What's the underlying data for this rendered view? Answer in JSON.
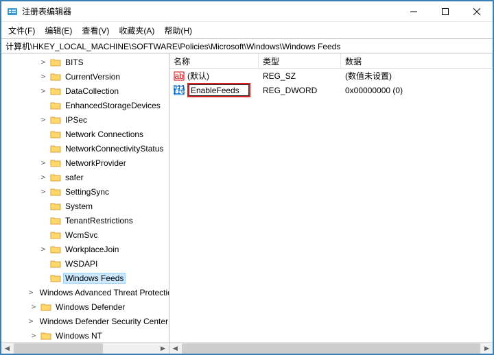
{
  "window": {
    "title": "注册表编辑器"
  },
  "menu": {
    "file": "文件(F)",
    "edit": "编辑(E)",
    "view": "查看(V)",
    "favorites": "收藏夹(A)",
    "help": "帮助(H)"
  },
  "address": {
    "path": "计算机\\HKEY_LOCAL_MACHINE\\SOFTWARE\\Policies\\Microsoft\\Windows\\Windows Feeds"
  },
  "tree": {
    "items": [
      {
        "indent": 54,
        "exp": ">",
        "label": "BITS"
      },
      {
        "indent": 54,
        "exp": ">",
        "label": "CurrentVersion"
      },
      {
        "indent": 54,
        "exp": ">",
        "label": "DataCollection"
      },
      {
        "indent": 54,
        "exp": "",
        "label": "EnhancedStorageDevices"
      },
      {
        "indent": 54,
        "exp": ">",
        "label": "IPSec"
      },
      {
        "indent": 54,
        "exp": "",
        "label": "Network Connections"
      },
      {
        "indent": 54,
        "exp": "",
        "label": "NetworkConnectivityStatus"
      },
      {
        "indent": 54,
        "exp": ">",
        "label": "NetworkProvider"
      },
      {
        "indent": 54,
        "exp": ">",
        "label": "safer"
      },
      {
        "indent": 54,
        "exp": ">",
        "label": "SettingSync"
      },
      {
        "indent": 54,
        "exp": "",
        "label": "System"
      },
      {
        "indent": 54,
        "exp": "",
        "label": "TenantRestrictions"
      },
      {
        "indent": 54,
        "exp": "",
        "label": "WcmSvc"
      },
      {
        "indent": 54,
        "exp": ">",
        "label": "WorkplaceJoin"
      },
      {
        "indent": 54,
        "exp": "",
        "label": "WSDAPI"
      },
      {
        "indent": 54,
        "exp": "",
        "label": "Windows Feeds",
        "selected": true
      },
      {
        "indent": 40,
        "exp": ">",
        "label": "Windows Advanced Threat Protection"
      },
      {
        "indent": 40,
        "exp": ">",
        "label": "Windows Defender"
      },
      {
        "indent": 40,
        "exp": ">",
        "label": "Windows Defender Security Center"
      },
      {
        "indent": 40,
        "exp": ">",
        "label": "Windows NT"
      }
    ]
  },
  "columns": {
    "name": "名称",
    "type": "类型",
    "data": "数据"
  },
  "values": {
    "default_name": "(默认)",
    "default_type": "REG_SZ",
    "default_data": "(数值未设置)",
    "enable_name": "EnableFeeds",
    "enable_type": "REG_DWORD",
    "enable_data": "0x00000000 (0)"
  }
}
